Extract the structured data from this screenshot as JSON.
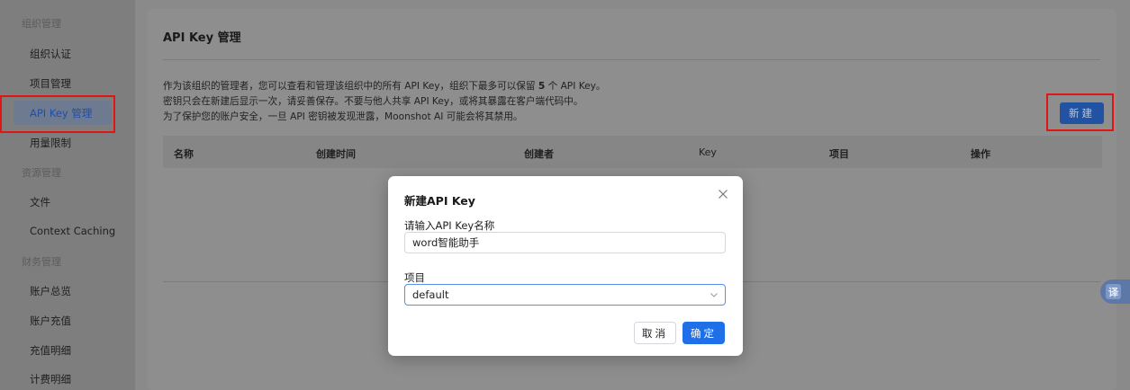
{
  "sidebar": {
    "group_org": "组织管理",
    "item_org_verify": "组织认证",
    "item_projects": "项目管理",
    "item_api_keys": "API Key 管理",
    "item_usage_limits": "用量限制",
    "group_resources": "资源管理",
    "item_files": "文件",
    "item_context_caching": "Context Caching",
    "group_finance": "财务管理",
    "item_account_overview": "账户总览",
    "item_recharge": "账户充值",
    "item_recharge_details": "充值明细",
    "item_billing_details": "计费明细"
  },
  "main": {
    "title": "API Key 管理",
    "desc1_pre": "作为该组织的管理者，您可以查看和管理该组织中的所有 API Key，组织下最多可以保留 ",
    "desc1_max": "5",
    "desc1_post": " 个 API Key。",
    "desc2": "密钥只会在新建后显示一次，请妥善保存。不要与他人共享 API Key，或将其暴露在客户端代码中。",
    "desc3": "为了保护您的账户安全，一旦 API 密钥被发现泄露，Moonshot AI 可能会将其禁用。",
    "new_button": "新建",
    "table_headers": [
      "名称",
      "创建时间",
      "创建者",
      "Key",
      "项目",
      "操作"
    ]
  },
  "translate_fab": "译",
  "modal": {
    "title": "新建API Key",
    "name_label": "请输入API Key名称",
    "name_value": "word智能助手",
    "project_label": "项目",
    "project_value": "default",
    "cancel": "取消",
    "confirm": "确定"
  },
  "colors": {
    "highlight_box": "#e01515",
    "primary": "#1f6fe8"
  },
  "icons": [
    "close-icon",
    "chevron-down-icon"
  ]
}
